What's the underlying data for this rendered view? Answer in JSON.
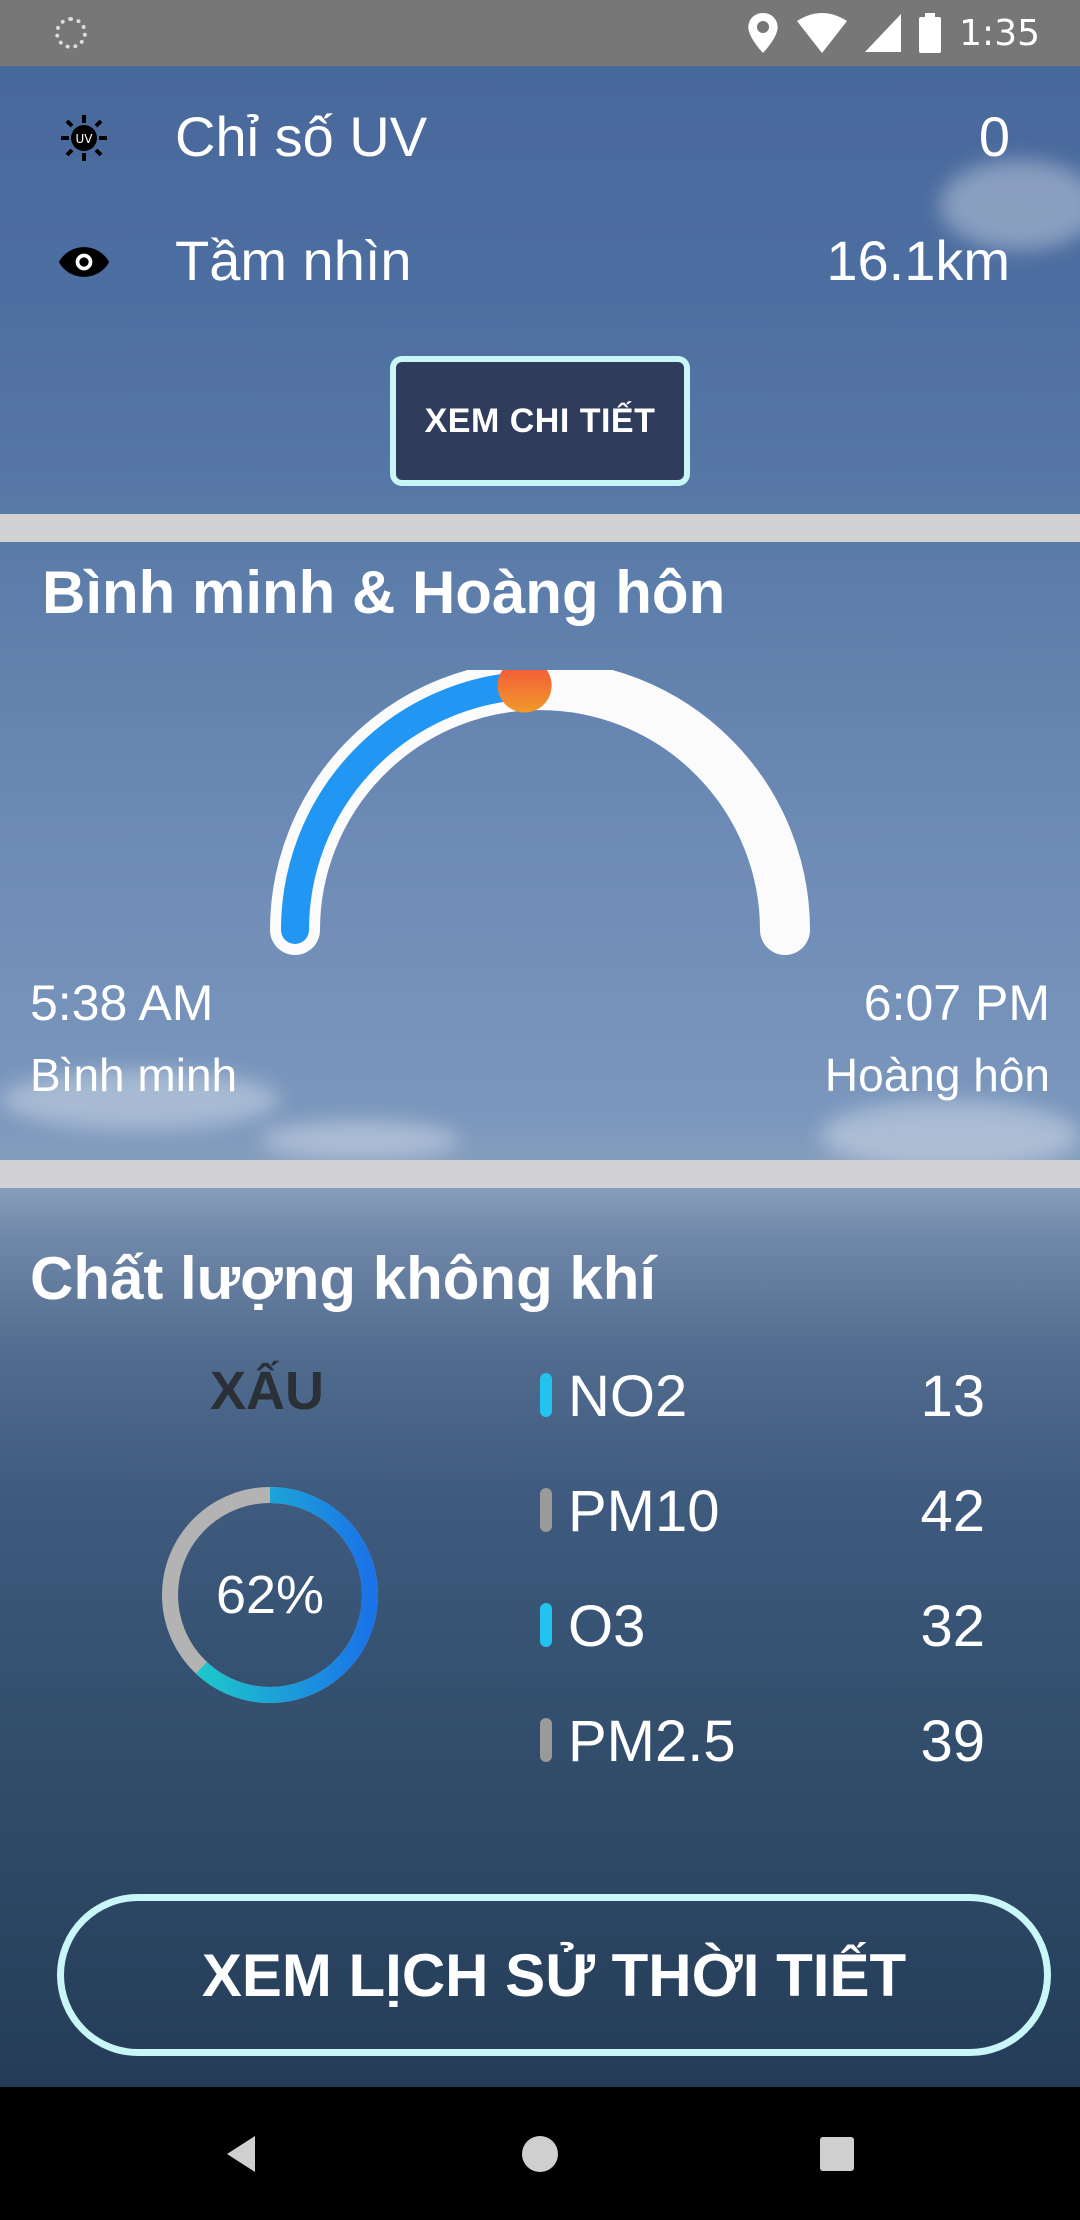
{
  "status_bar": {
    "time": "1:35"
  },
  "details": {
    "uv": {
      "label": "Chỉ số UV",
      "value": "0"
    },
    "visibility": {
      "label": "Tầm nhìn",
      "value": "16.1km"
    },
    "detail_button": "XEM CHI TIẾT"
  },
  "sun": {
    "title": "Bình minh & Hoàng hôn",
    "sunrise_time": "5:38 AM",
    "sunrise_label": "Bình minh",
    "sunset_time": "6:07 PM",
    "sunset_label": "Hoàng hôn",
    "day_progress": 0.48
  },
  "air_quality": {
    "title": "Chất lượng không khí",
    "status": "XẤU",
    "percent_label": "62%",
    "percent": 62,
    "pollutants": [
      {
        "name": "NO2",
        "value": "13",
        "color": "#22c3ee"
      },
      {
        "name": "PM10",
        "value": "42",
        "color": "#9a9a9a"
      },
      {
        "name": "O3",
        "value": "32",
        "color": "#22c3ee"
      },
      {
        "name": "PM2.5",
        "value": "39",
        "color": "#9a9a9a"
      }
    ]
  },
  "history_button": "XEM LỊCH SỬ THỜI TIẾT",
  "colors": {
    "accent_border": "#c9f7f8",
    "arc_progress": "#2196f3",
    "sun_dot": "#f06a35"
  }
}
